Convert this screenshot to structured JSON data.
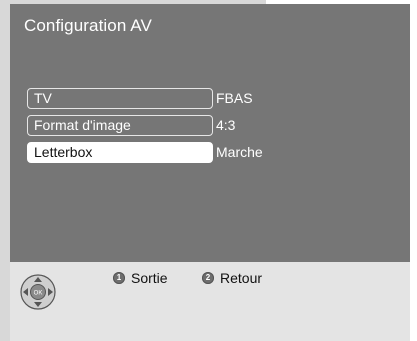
{
  "menu": {
    "title": "Configuration AV",
    "items": [
      {
        "label": "TV",
        "value": "FBAS",
        "selected": false
      },
      {
        "label": "Format d'image",
        "value": "4:3",
        "selected": false
      },
      {
        "label": "Letterbox",
        "value": "Marche",
        "selected": true
      }
    ]
  },
  "footer": {
    "nav_icon": "ok-navigation-pad-icon",
    "nav_center_label": "OK",
    "hints": [
      {
        "key": "1",
        "icon": "button-1-icon",
        "label": "Sortie"
      },
      {
        "key": "2",
        "icon": "button-2-icon",
        "label": "Retour"
      }
    ]
  },
  "colors": {
    "screen_bg": "#767676",
    "footer_bg": "#e4e4e4",
    "selected_bg": "#ffffff",
    "text_on_screen": "#ffffff"
  }
}
